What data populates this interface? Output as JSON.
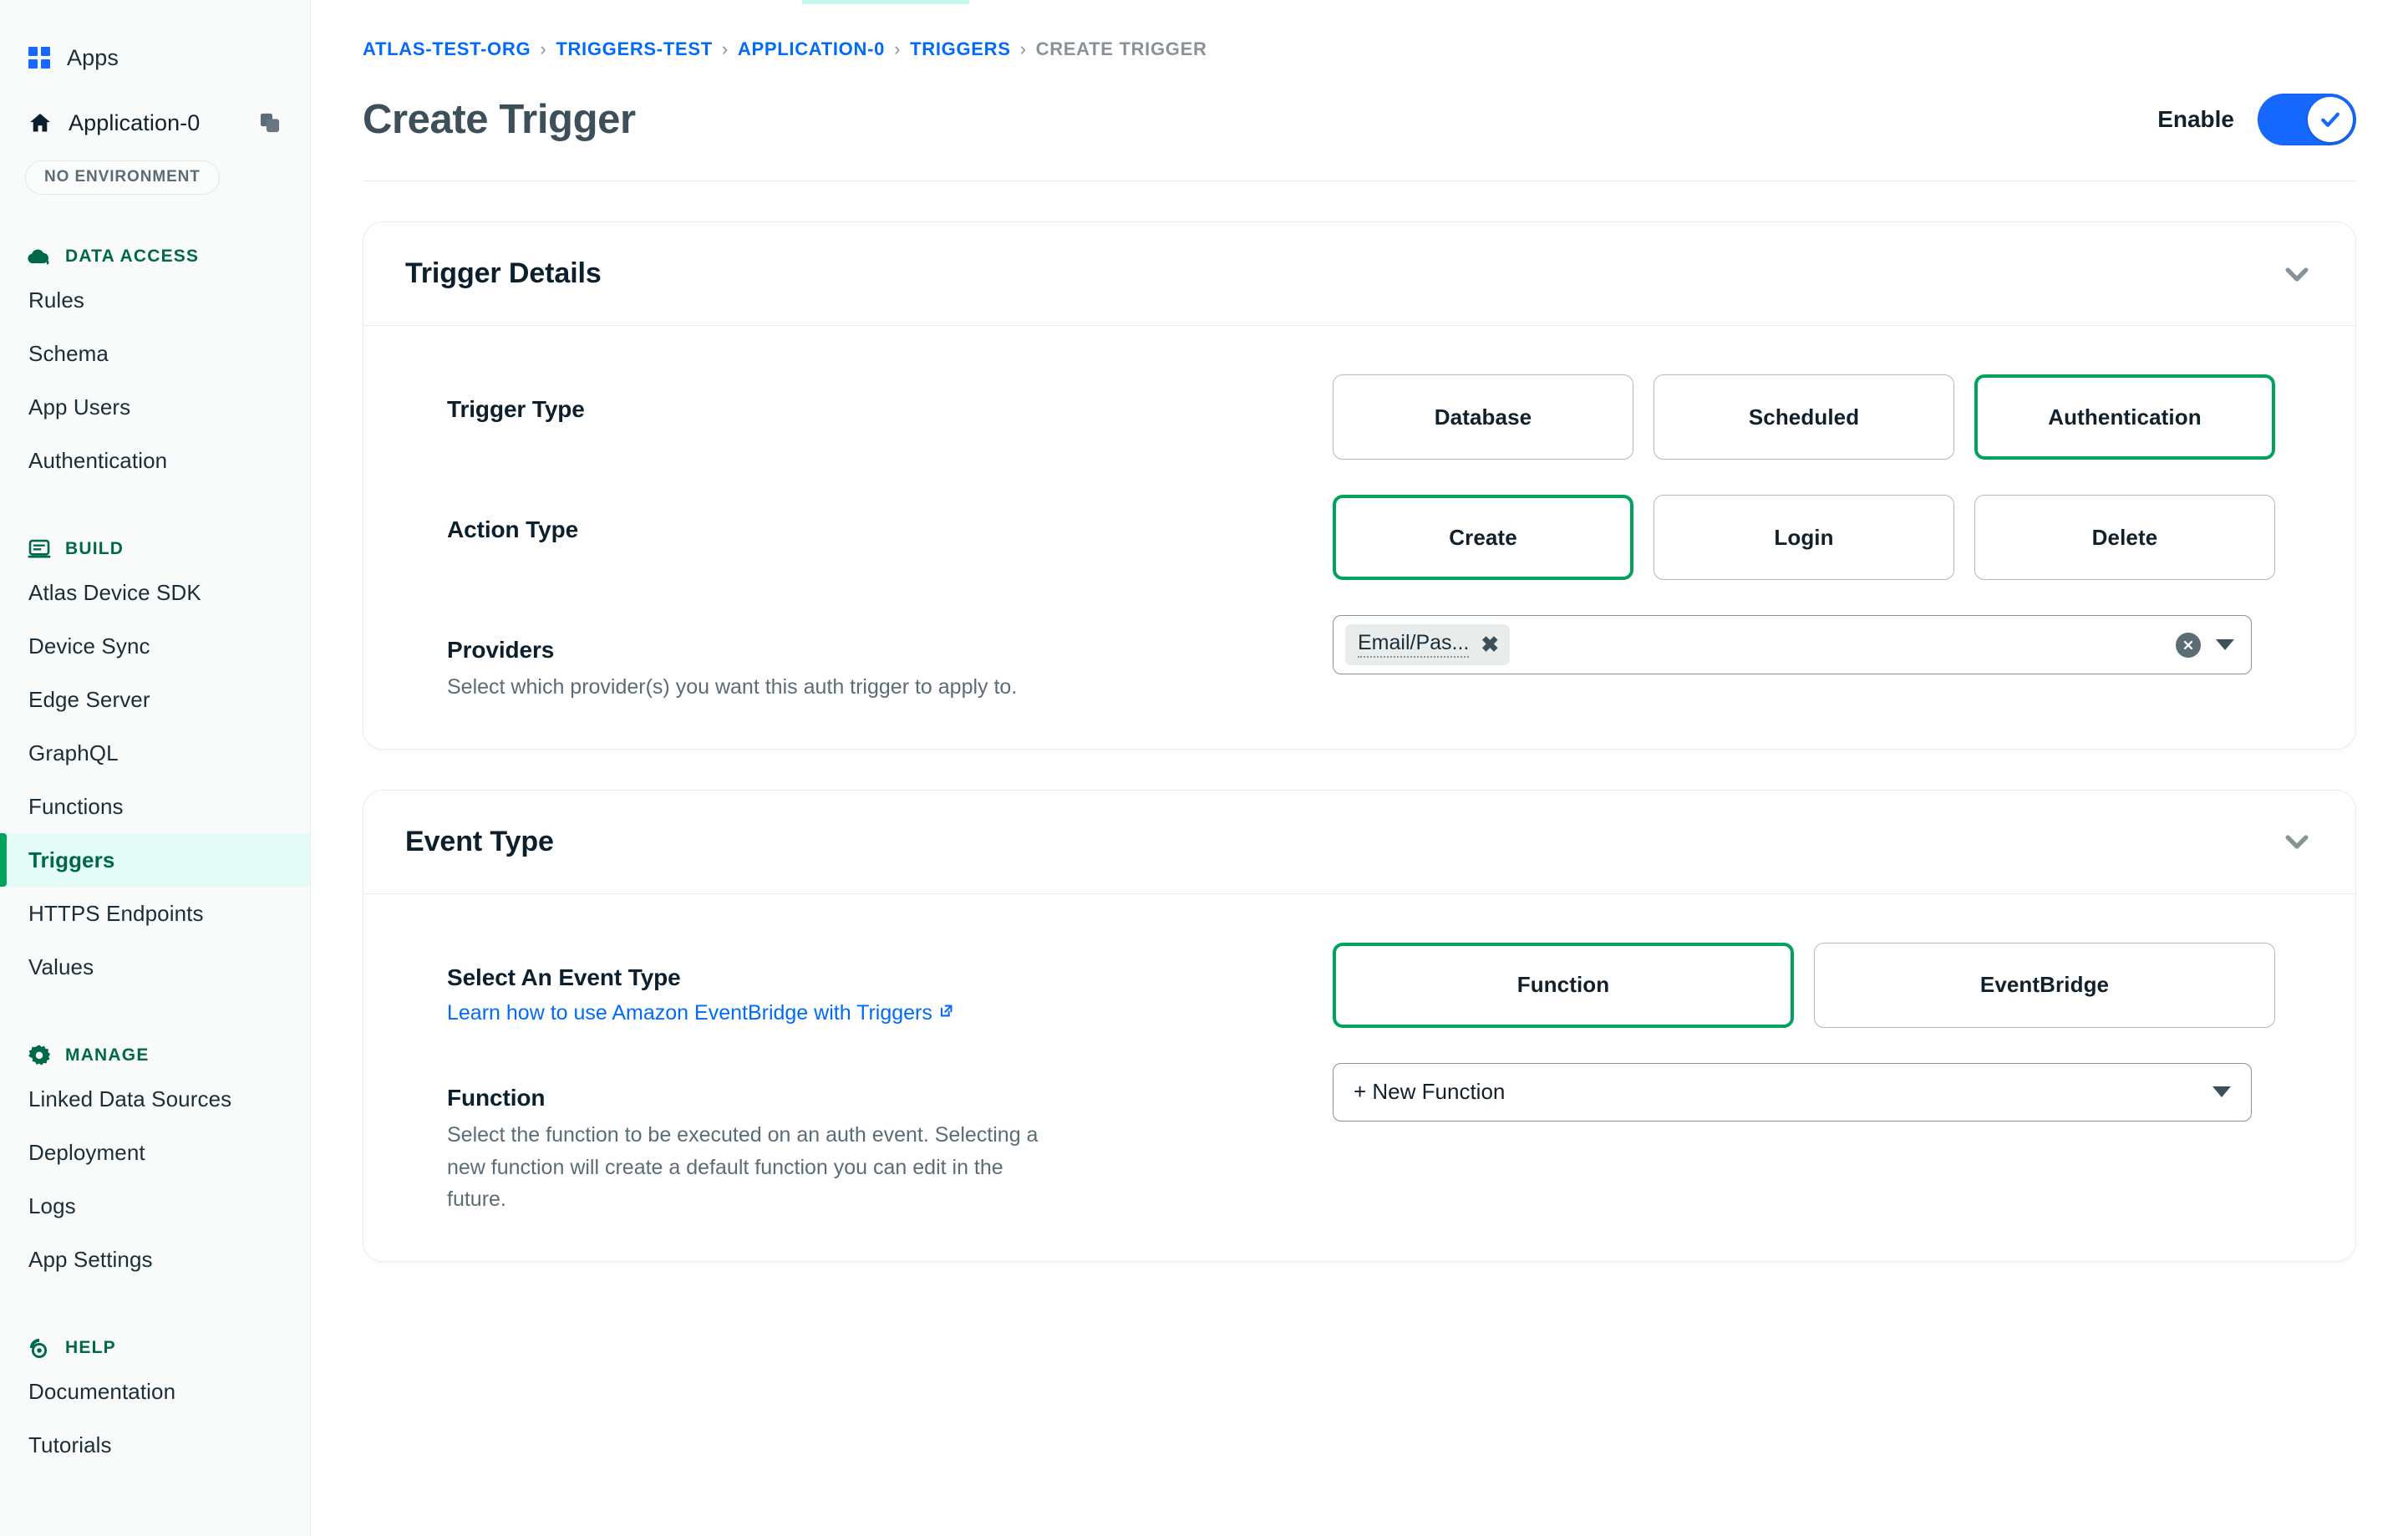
{
  "sidebar": {
    "apps_label": "Apps",
    "apps_icon": "apps-grid-icon",
    "app_name": "Application-0",
    "home_icon": "home-icon",
    "copy_icon": "copy-icon",
    "environment_badge": "NO ENVIRONMENT",
    "sections": [
      {
        "label": "DATA ACCESS",
        "icon": "cloud-icon",
        "items": [
          {
            "label": "Rules",
            "active": false
          },
          {
            "label": "Schema",
            "active": false
          },
          {
            "label": "App Users",
            "active": false
          },
          {
            "label": "Authentication",
            "active": false
          }
        ]
      },
      {
        "label": "BUILD",
        "icon": "laptop-icon",
        "items": [
          {
            "label": "Atlas Device SDK",
            "active": false
          },
          {
            "label": "Device Sync",
            "active": false
          },
          {
            "label": "Edge Server",
            "active": false
          },
          {
            "label": "GraphQL",
            "active": false
          },
          {
            "label": "Functions",
            "active": false
          },
          {
            "label": "Triggers",
            "active": true
          },
          {
            "label": "HTTPS Endpoints",
            "active": false
          },
          {
            "label": "Values",
            "active": false
          }
        ]
      },
      {
        "label": "MANAGE",
        "icon": "gear-icon",
        "items": [
          {
            "label": "Linked Data Sources",
            "active": false
          },
          {
            "label": "Deployment",
            "active": false
          },
          {
            "label": "Logs",
            "active": false
          },
          {
            "label": "App Settings",
            "active": false
          }
        ]
      },
      {
        "label": "HELP",
        "icon": "lifering-icon",
        "items": [
          {
            "label": "Documentation",
            "active": false
          },
          {
            "label": "Tutorials",
            "active": false
          }
        ]
      }
    ]
  },
  "breadcrumb": {
    "items": [
      {
        "label": "ATLAS-TEST-ORG",
        "current": false
      },
      {
        "label": "TRIGGERS-TEST",
        "current": false
      },
      {
        "label": "APPLICATION-0",
        "current": false
      },
      {
        "label": "TRIGGERS",
        "current": false
      },
      {
        "label": "CREATE TRIGGER",
        "current": true
      }
    ],
    "separator": "›"
  },
  "header": {
    "title": "Create Trigger",
    "enable_label": "Enable",
    "enable_on": true,
    "toggle_icon": "check-icon"
  },
  "trigger_details": {
    "section_title": "Trigger Details",
    "collapse_icon": "chevron-down-icon",
    "trigger_type": {
      "label": "Trigger Type",
      "options": [
        "Database",
        "Scheduled",
        "Authentication"
      ],
      "selected": "Authentication"
    },
    "action_type": {
      "label": "Action Type",
      "options": [
        "Create",
        "Login",
        "Delete"
      ],
      "selected": "Create"
    },
    "providers": {
      "label": "Providers",
      "description": "Select which provider(s) you want this auth trigger to apply to.",
      "chips": [
        "Email/Pas..."
      ],
      "chip_remove_icon": "close-icon",
      "clear_icon": "clear-all-icon",
      "caret_icon": "caret-down-icon"
    }
  },
  "event_type": {
    "section_title": "Event Type",
    "collapse_icon": "chevron-down-icon",
    "select_event": {
      "label": "Select An Event Type",
      "link_text": "Learn how to use Amazon EventBridge with Triggers",
      "link_icon": "external-link-icon",
      "options": [
        "Function",
        "EventBridge"
      ],
      "selected": "Function"
    },
    "function": {
      "label": "Function",
      "description": "Select the function to be executed on an auth event. Selecting a new function will create a default function you can edit in the future.",
      "selected_value": "+ New Function",
      "caret_icon": "caret-down-icon"
    }
  },
  "colors": {
    "accent_green": "#00A35C",
    "dark_green": "#00684A",
    "link_blue": "#016BF8",
    "toggle_blue": "#1668FF",
    "active_bg": "#E3FCF7"
  }
}
